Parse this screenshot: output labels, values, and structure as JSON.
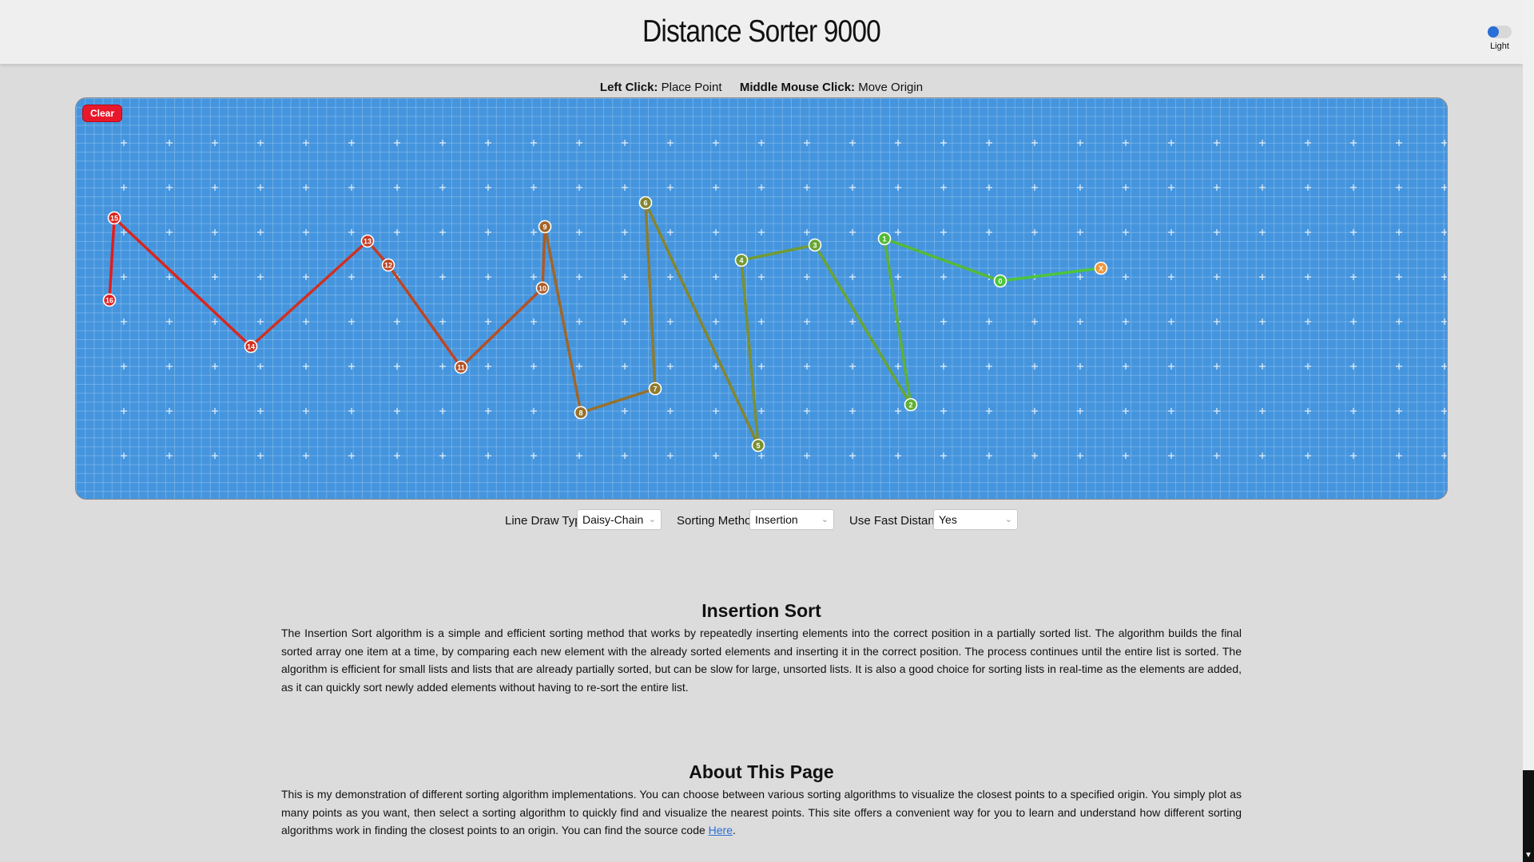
{
  "header": {
    "title": "Distance Sorter 9000",
    "theme_toggle_label": "Light"
  },
  "instructions": {
    "left_click_key": "Left Click:",
    "left_click_action": "Place Point",
    "middle_click_key": "Middle Mouse Click:",
    "middle_click_action": "Move Origin"
  },
  "canvas": {
    "clear_label": "Clear",
    "background_color": "#4595de",
    "origin_label": "X",
    "origin_color": "#f0963c",
    "path_color_near": "#4cc53a",
    "path_color_far": "#e21c1c",
    "points": [
      {
        "label": "0"
      },
      {
        "label": "1"
      },
      {
        "label": "2"
      },
      {
        "label": "3"
      },
      {
        "label": "4"
      },
      {
        "label": "5"
      },
      {
        "label": "6"
      },
      {
        "label": "7"
      },
      {
        "label": "8"
      },
      {
        "label": "9"
      },
      {
        "label": "10"
      },
      {
        "label": "11"
      },
      {
        "label": "12"
      },
      {
        "label": "13"
      },
      {
        "label": "14"
      },
      {
        "label": "15"
      },
      {
        "label": "16"
      }
    ]
  },
  "controls": {
    "line_draw_type_label": "Line Draw Type:",
    "line_draw_type_value": "Daisy-Chain",
    "sorting_method_label": "Sorting Method:",
    "sorting_method_value": "Insertion",
    "fast_distance_label": "Use Fast Distance:",
    "fast_distance_value": "Yes"
  },
  "sections": {
    "insertion_title": "Insertion Sort",
    "insertion_body": "The Insertion Sort algorithm is a simple and efficient sorting method that works by repeatedly inserting elements into the correct position in a partially sorted list. The algorithm builds the final sorted array one item at a time, by comparing each new element with the already sorted elements and inserting it in the correct position. The process continues until the entire list is sorted. The algorithm is efficient for small lists and lists that are already partially sorted, but can be slow for large, unsorted lists. It is also a good choice for sorting lists in real-time as the elements are added, as it can quickly sort newly added elements without having to re-sort the entire list.",
    "about_title": "About This Page",
    "about_body": "This is my demonstration of different sorting algorithm implementations. You can choose between various sorting algorithms to visualize the closest points to a specified origin. You simply plot as many points as you want, then select a sorting algorithm to quickly find and visualize the nearest points. This site offers a convenient way for you to learn and understand how different sorting algorithms work in finding the closest points to an origin. You can find the source code ",
    "about_link": "Here",
    "about_end": "."
  }
}
